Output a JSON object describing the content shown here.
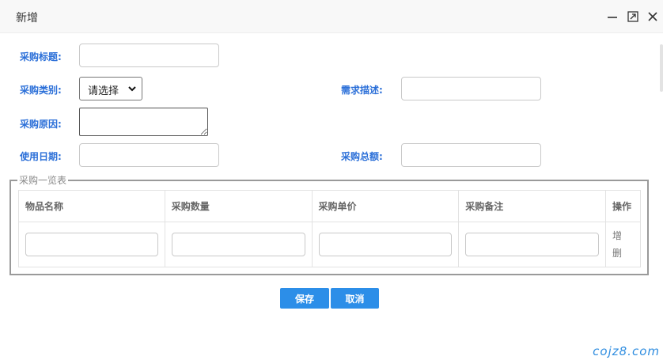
{
  "dialog": {
    "title": "新增",
    "controls": {
      "minimize_icon": "minimize-icon",
      "maximize_icon": "maximize-icon",
      "close_icon": "close-icon"
    }
  },
  "form": {
    "title_label": "采购标题:",
    "title_value": "",
    "category_label": "采购类别:",
    "category_selected": "请选择",
    "reason_label": "采购原因:",
    "reason_value": "",
    "date_label": "使用日期:",
    "date_value": "",
    "demand_label": "需求描述:",
    "demand_value": "",
    "total_label": "采购总额:",
    "total_value": ""
  },
  "list": {
    "legend": "采购一览表",
    "columns": [
      "物品名称",
      "采购数量",
      "采购单价",
      "采购备注",
      "操作"
    ],
    "row_actions": {
      "add": "增",
      "delete": "删"
    }
  },
  "actions": {
    "save": "保存",
    "cancel": "取消"
  },
  "watermark": "cojz8.com",
  "colors": {
    "label": "#2b6fd8",
    "button": "#2c8ee8"
  }
}
